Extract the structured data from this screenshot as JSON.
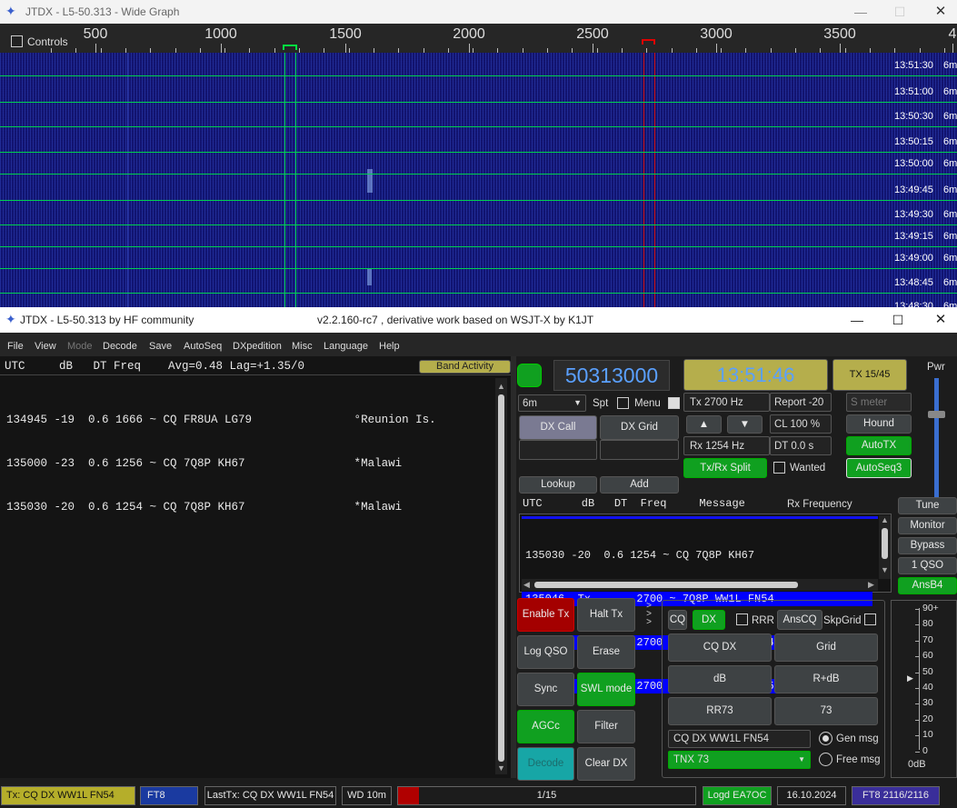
{
  "wide_graph": {
    "title": "JTDX - L5-50.313 - Wide Graph",
    "controls_label": "Controls",
    "scale_labels": [
      "500",
      "1000",
      "1500",
      "2000",
      "2500",
      "3000",
      "3500",
      "4"
    ],
    "timestamps": [
      "13:51:30",
      "13:51:00",
      "13:50:30",
      "13:50:15",
      "13:50:00",
      "13:49:45",
      "13:49:30",
      "13:49:15",
      "13:49:00",
      "13:48:45",
      "13:48:30"
    ],
    "band_label": "6m"
  },
  "main_window": {
    "title": "JTDX - L5-50.313  by HF community",
    "subtitle": "v2.2.160-rc7 , derivative work based on WSJT-X by K1JT"
  },
  "menu": [
    "File",
    "View",
    "Mode",
    "Decode",
    "Save",
    "AutoSeq",
    "DXpedition",
    "Misc",
    "Language",
    "Help"
  ],
  "band_activity": {
    "header": "UTC     dB   DT Freq    Avg=0.48 Lag=+1.35/0",
    "button": "Band Activity",
    "lines": [
      "134945 -19  0.6 1666 ~ CQ FR8UA LG79               °Reunion Is.",
      "135000 -23  0.6 1256 ~ CQ 7Q8P KH67                *Malawi",
      "135030 -20  0.6 1254 ~ CQ 7Q8P KH67                *Malawi"
    ]
  },
  "controls": {
    "frequency": "50313000",
    "clock": "13:51:46",
    "tx_period": "TX 15/45",
    "band": "6m",
    "spt": "Spt",
    "menu": "Menu",
    "dx_call": "DX Call",
    "dx_grid": "DX Grid",
    "tx_freq": "Tx  2700  Hz",
    "rx_freq": "Rx  1254  Hz",
    "report": "Report -20",
    "s_meter": "S meter",
    "cl": "CL  100 %",
    "dt": "DT 0.0 s",
    "hound": "Hound",
    "autotx": "AutoTX",
    "split": "Tx/Rx Split",
    "wanted": "Wanted",
    "autoseq": "AutoSeq3",
    "lookup": "Lookup",
    "add": "Add",
    "pwr": "Pwr",
    "up": "▲",
    "down": "▼"
  },
  "rx_frequency": {
    "header": "UTC      dB   DT  Freq     Message",
    "rx_label": "Rx Frequency",
    "lines": [
      "135030 -20  0.6 1254 ~ CQ 7Q8P KH67",
      "135046  Tx       2700 ~ 7Q8P WW1L FN54",
      "135115  Tx       2700 ~ 7Q8P WW1L FN54",
      "135145  Tx       2700 ~ CQ DX WW1L FN54"
    ]
  },
  "right_buttons": [
    "Tune",
    "Monitor",
    "Bypass",
    "1 QSO",
    "AnsB4"
  ],
  "action_buttons": {
    "enable_tx": "Enable Tx",
    "halt_tx": "Halt Tx",
    "log_qso": "Log QSO",
    "erase": "Erase",
    "sync": "Sync",
    "swl": "SWL mode",
    "agcc": "AGCc",
    "filter": "Filter",
    "decode": "Decode",
    "clear_dx": "Clear DX"
  },
  "messages": {
    "cq": "CQ",
    "dx": "DX",
    "rrr": "RRR",
    "anscq": "AnsCQ",
    "skpgrid": "SkpGrid",
    "cq_dx": "CQ DX",
    "grid": "Grid",
    "db": "dB",
    "r_db": "R+dB",
    "rr73": "RR73",
    "s73": "73",
    "gen_msg_text": "CQ DX WW1L FN54",
    "gen_msg": "Gen msg",
    "free_msg_text": "TNX 73",
    "free_msg": "Free msg"
  },
  "meter": {
    "labels": [
      "90+",
      "80",
      "70",
      "60",
      "50",
      "40",
      "30",
      "20",
      "10",
      "0"
    ],
    "value": "0dB"
  },
  "status": {
    "tx": "Tx: CQ DX WW1L FN54",
    "mode": "FT8",
    "last_tx": "LastTx: CQ DX WW1L FN54",
    "wd": "WD 10m",
    "progress": "1/15",
    "logd": "Logd EA7OC",
    "date": "16.10.2024",
    "ft8": "FT8  2116/2116",
    "progress_fraction": 0.07
  },
  "colors": {
    "accent_green": "#10a020",
    "tx_red": "#a40000",
    "rx_blue": "#0000ff",
    "freq_blue": "#5aa0ff"
  }
}
